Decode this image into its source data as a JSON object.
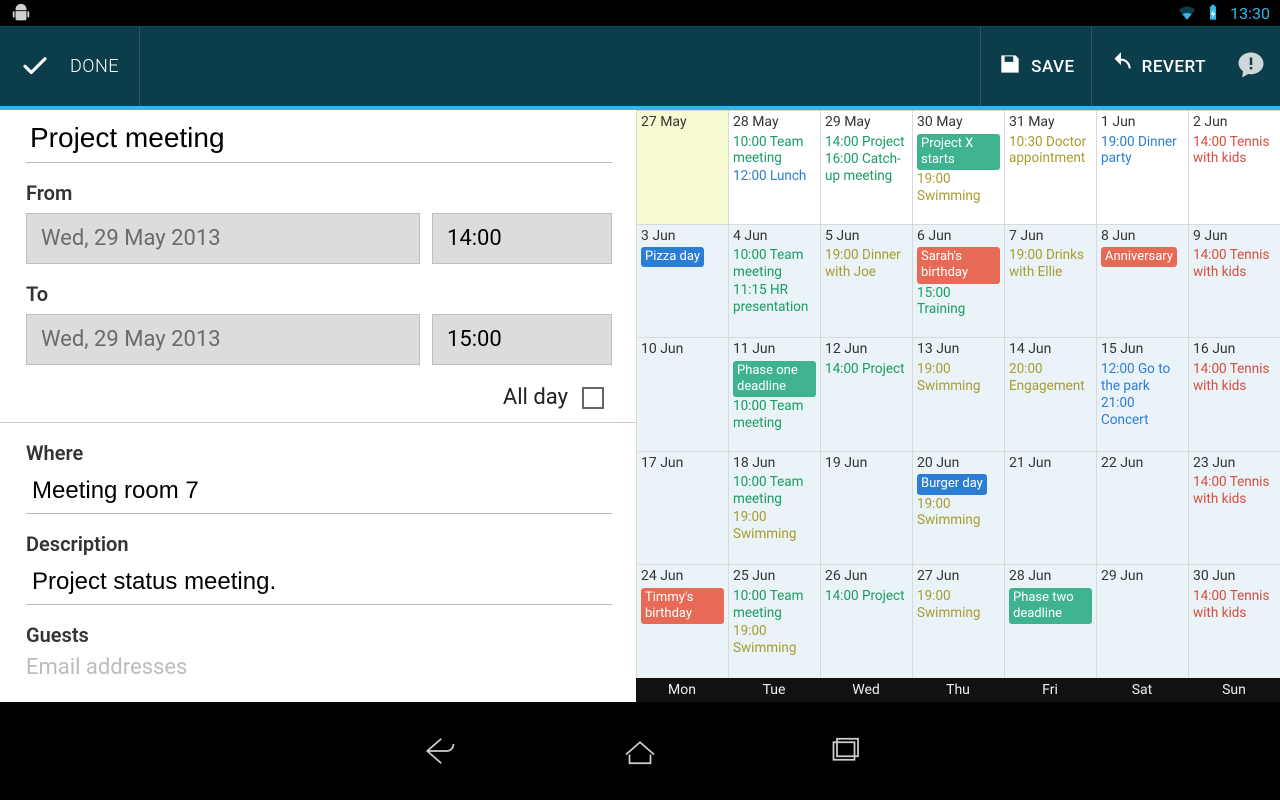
{
  "status": {
    "time": "13:30"
  },
  "actionbar": {
    "done": "DONE",
    "save": "SAVE",
    "revert": "REVERT"
  },
  "form": {
    "title_value": "Project meeting",
    "from_label": "From",
    "to_label": "To",
    "from_date": "Wed, 29 May 2013",
    "from_time": "14:00",
    "to_date": "Wed, 29 May 2013",
    "to_time": "15:00",
    "allday_label": "All day",
    "allday_checked": false,
    "where_label": "Where",
    "where_value": "Meeting room 7",
    "description_label": "Description",
    "description_value": "Project status meeting.",
    "guests_label": "Guests",
    "guests_placeholder": "Email addresses"
  },
  "calendar": {
    "weekday_labels": [
      "Mon",
      "Tue",
      "Wed",
      "Thu",
      "Fri",
      "Sat",
      "Sun"
    ],
    "weeks": [
      [
        {
          "day": "27 May",
          "highlight": true,
          "current_week": true,
          "events": []
        },
        {
          "day": "28 May",
          "current_week": true,
          "events": [
            {
              "text": "10:00 Team meeting",
              "style": "green"
            },
            {
              "text": "12:00 Lunch",
              "style": "blue"
            }
          ]
        },
        {
          "day": "29 May",
          "current_week": true,
          "events": [
            {
              "text": "14:00 Project",
              "style": "green"
            },
            {
              "text": "16:00 Catch-up meeting",
              "style": "green"
            }
          ]
        },
        {
          "day": "30 May",
          "current_week": true,
          "events": [
            {
              "text": "Project X starts",
              "style": "block teal"
            },
            {
              "text": "19:00 Swimming",
              "style": "olive"
            }
          ]
        },
        {
          "day": "31 May",
          "current_week": true,
          "events": [
            {
              "text": "10:30 Doctor appointment",
              "style": "olive"
            }
          ]
        },
        {
          "day": "1 Jun",
          "current_week": true,
          "events": [
            {
              "text": "19:00 Dinner party",
              "style": "blue"
            }
          ]
        },
        {
          "day": "2 Jun",
          "current_week": true,
          "events": [
            {
              "text": "14:00 Tennis with kids",
              "style": "red"
            }
          ]
        }
      ],
      [
        {
          "day": "3 Jun",
          "events": [
            {
              "text": "Pizza day",
              "style": "block bluebg"
            }
          ]
        },
        {
          "day": "4 Jun",
          "events": [
            {
              "text": "10:00 Team meeting",
              "style": "green"
            },
            {
              "text": "11:15 HR presentation",
              "style": "green"
            }
          ]
        },
        {
          "day": "5 Jun",
          "events": [
            {
              "text": "19:00 Dinner with Joe",
              "style": "olive"
            }
          ]
        },
        {
          "day": "6 Jun",
          "events": [
            {
              "text": "Sarah's birthday",
              "style": "block redbg"
            },
            {
              "text": "15:00 Training",
              "style": "green"
            }
          ]
        },
        {
          "day": "7 Jun",
          "events": [
            {
              "text": "19:00 Drinks with Ellie",
              "style": "olive"
            }
          ]
        },
        {
          "day": "8 Jun",
          "events": [
            {
              "text": "Anniversary",
              "style": "block redbg"
            }
          ]
        },
        {
          "day": "9 Jun",
          "events": [
            {
              "text": "14:00 Tennis with kids",
              "style": "red"
            }
          ]
        }
      ],
      [
        {
          "day": "10 Jun",
          "events": []
        },
        {
          "day": "11 Jun",
          "events": [
            {
              "text": "Phase one deadline",
              "style": "block teal"
            },
            {
              "text": "10:00 Team meeting",
              "style": "green"
            }
          ]
        },
        {
          "day": "12 Jun",
          "events": [
            {
              "text": "14:00 Project",
              "style": "green"
            }
          ]
        },
        {
          "day": "13 Jun",
          "events": [
            {
              "text": "19:00 Swimming",
              "style": "olive"
            }
          ]
        },
        {
          "day": "14 Jun",
          "events": [
            {
              "text": "20:00 Engagement",
              "style": "olive"
            }
          ]
        },
        {
          "day": "15 Jun",
          "events": [
            {
              "text": "12:00 Go to the park",
              "style": "blue"
            },
            {
              "text": "21:00 Concert",
              "style": "blue"
            }
          ]
        },
        {
          "day": "16 Jun",
          "events": [
            {
              "text": "14:00 Tennis with kids",
              "style": "red"
            }
          ]
        }
      ],
      [
        {
          "day": "17 Jun",
          "events": []
        },
        {
          "day": "18 Jun",
          "events": [
            {
              "text": "10:00 Team meeting",
              "style": "green"
            },
            {
              "text": "19:00 Swimming",
              "style": "olive"
            }
          ]
        },
        {
          "day": "19 Jun",
          "events": []
        },
        {
          "day": "20 Jun",
          "events": [
            {
              "text": "Burger day",
              "style": "block bluebg"
            },
            {
              "text": "19:00 Swimming",
              "style": "olive"
            }
          ]
        },
        {
          "day": "21 Jun",
          "events": []
        },
        {
          "day": "22 Jun",
          "events": []
        },
        {
          "day": "23 Jun",
          "events": [
            {
              "text": "14:00 Tennis with kids",
              "style": "red"
            }
          ]
        }
      ],
      [
        {
          "day": "24 Jun",
          "events": [
            {
              "text": "Timmy's birthday",
              "style": "block redbg"
            }
          ]
        },
        {
          "day": "25 Jun",
          "events": [
            {
              "text": "10:00 Team meeting",
              "style": "green"
            },
            {
              "text": "19:00 Swimming",
              "style": "olive"
            }
          ]
        },
        {
          "day": "26 Jun",
          "events": [
            {
              "text": "14:00 Project",
              "style": "green"
            }
          ]
        },
        {
          "day": "27 Jun",
          "events": [
            {
              "text": "19:00 Swimming",
              "style": "olive"
            }
          ]
        },
        {
          "day": "28 Jun",
          "events": [
            {
              "text": "Phase two deadline",
              "style": "block teal"
            }
          ]
        },
        {
          "day": "29 Jun",
          "events": []
        },
        {
          "day": "30 Jun",
          "events": [
            {
              "text": "14:00 Tennis with kids",
              "style": "red"
            }
          ]
        }
      ]
    ]
  }
}
